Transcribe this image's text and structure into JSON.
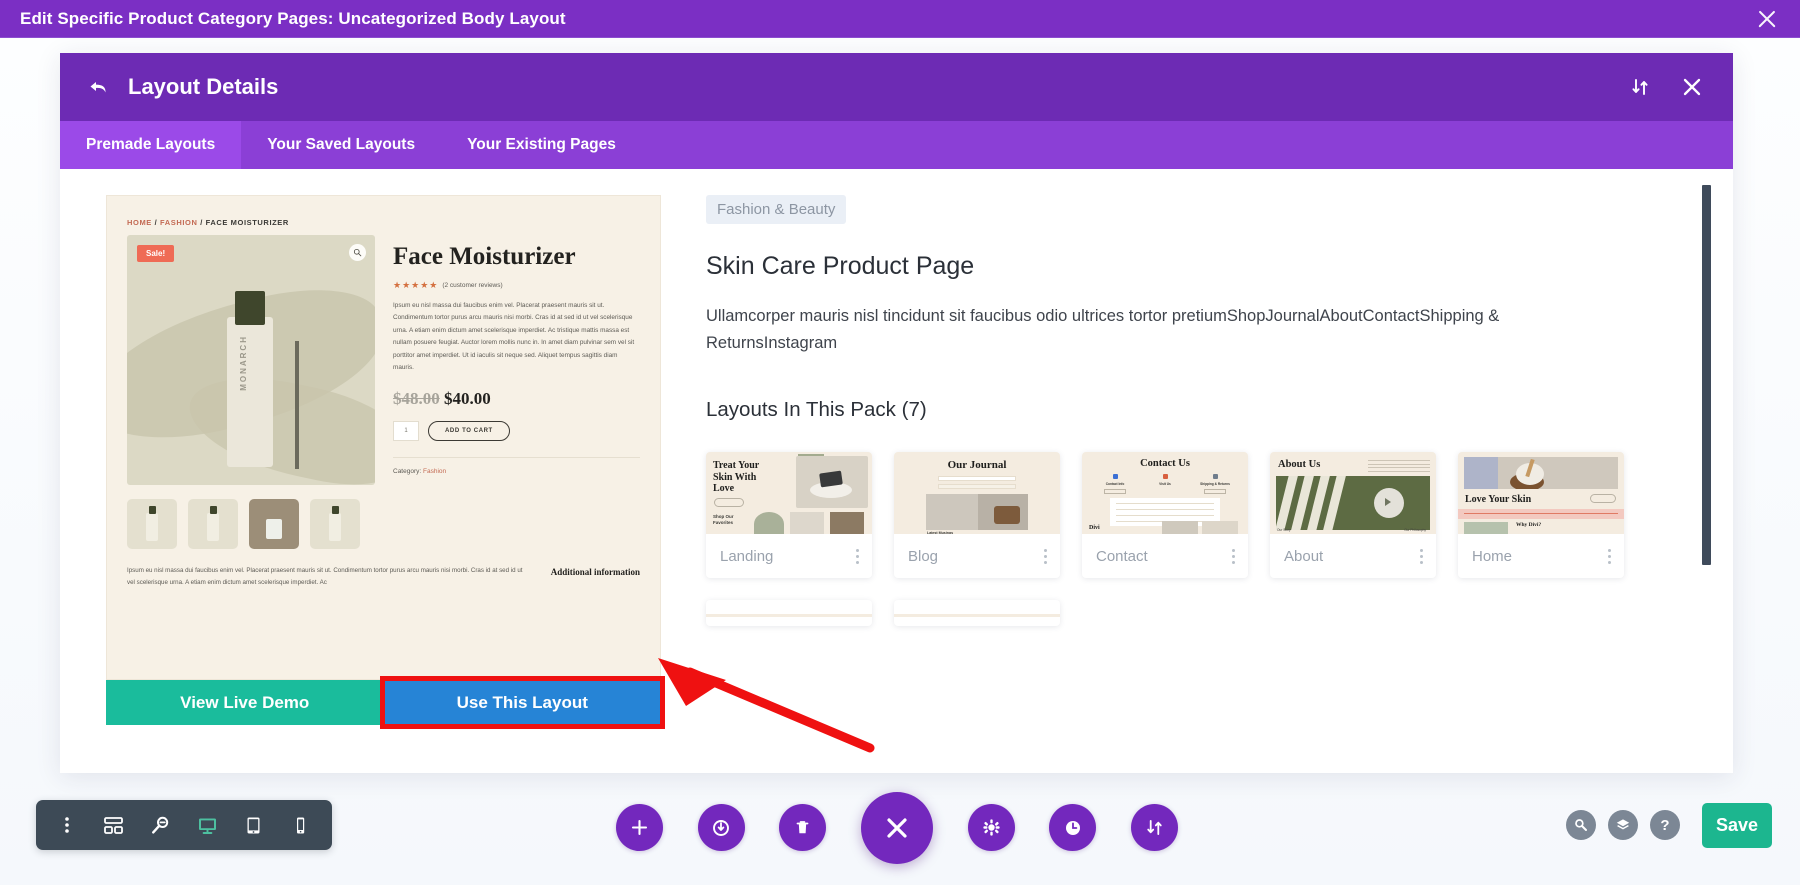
{
  "titlebar": {
    "title": "Edit Specific Product Category Pages: Uncategorized Body Layout",
    "close_icon": "close-icon"
  },
  "modal": {
    "header": {
      "back_icon": "back-arrow-icon",
      "title": "Layout Details",
      "sort_icon": "sort-arrows-icon",
      "close_icon": "close-icon"
    },
    "tabs": [
      {
        "label": "Premade Layouts",
        "active": true
      },
      {
        "label": "Your Saved Layouts",
        "active": false
      },
      {
        "label": "Your Existing Pages",
        "active": false
      }
    ]
  },
  "preview": {
    "breadcrumb_home": "HOME",
    "breadcrumb_cat": "FASHION",
    "breadcrumb_current": "/ FACE MOISTURIZER",
    "sale_badge": "Sale!",
    "zoom_icon": "magnifier-icon",
    "bottle_label": "MONARCH",
    "product_title": "Face Moisturizer",
    "stars": "★★★★★",
    "reviews": "(2 customer reviews)",
    "description": "Ipsum eu nisl massa dui faucibus enim vel. Placerat praesent mauris sit ut. Condimentum tortor purus arcu mauris nisi morbi. Cras id at sed id ut vel scelerisque urna. A etiam enim dictum amet scelerisque imperdiet. Ac tristique mattis massa est nullam posuere feugiat. Auctor lorem mollis nunc in. In amet diam pulvinar sem vel sit porttitor amet imperdiet. Ut id iaculis sit neque sed. Aliquet tempus sagittis diam mauris.",
    "price_old": "$48.00",
    "price_new": "$40.00",
    "qty_value": "1",
    "add_to_cart": "ADD TO CART",
    "category_label": "Category:",
    "category_value": "Fashion",
    "footer_text": "Ipsum eu nisl massa dui faucibus enim vel. Placerat praesent mauris sit ut. Condimentum tortor purus arcu mauris nisi morbi. Cras id at sed id ut vel scelerisque urna. A etiam enim dictum amet scelerisque imperdiet. Ac",
    "additional_info": "Additional information",
    "btn_demo": "View Live Demo",
    "btn_use": "Use This Layout"
  },
  "detail": {
    "category_badge": "Fashion & Beauty",
    "title": "Skin Care Product Page",
    "description": "Ullamcorper mauris nisl tincidunt sit faucibus odio ultrices tortor pretiumShopJournalAboutContactShipping & ReturnsInstagram",
    "pack_heading": "Layouts In This Pack (7)",
    "cards": [
      {
        "label": "Landing",
        "thumb_heading": "Treat Your\nSkin With\nLove",
        "thumb_sub": "Shop Our\nFavorites"
      },
      {
        "label": "Blog",
        "thumb_heading": "Our Journal",
        "thumb_sub": "Latest Musings"
      },
      {
        "label": "Contact",
        "thumb_heading": "Contact Us",
        "thumb_sub": "Divi",
        "cols": [
          {
            "label": "Contact Info",
            "btn": "Get In Touch"
          },
          {
            "label": "Visit Us",
            "btn": ""
          },
          {
            "label": "Shipping & Returns",
            "btn": "Read More"
          }
        ]
      },
      {
        "label": "About",
        "thumb_heading": "About Us",
        "cap_left": "Our Story",
        "cap_right": "Our Philosophy"
      },
      {
        "label": "Home",
        "thumb_heading": "Love Your Skin",
        "thumb_sub": "Why Divi?"
      }
    ],
    "menu_icon": "three-dots-vertical-icon",
    "scrollbar": "vertical-scrollbar"
  },
  "left_toolbar": {
    "items": [
      {
        "icon": "three-dots-vertical-icon",
        "active": false
      },
      {
        "icon": "wireframe-icon",
        "active": false
      },
      {
        "icon": "zoom-out-icon",
        "active": false
      },
      {
        "icon": "desktop-icon",
        "active": true
      },
      {
        "icon": "tablet-icon",
        "active": false
      },
      {
        "icon": "phone-icon",
        "active": false
      }
    ]
  },
  "center_bar": {
    "buttons": [
      {
        "icon": "plus-icon",
        "big": false
      },
      {
        "icon": "power-save-icon",
        "big": false
      },
      {
        "icon": "trash-icon",
        "big": false
      },
      {
        "icon": "close-x-icon",
        "big": true
      },
      {
        "icon": "gear-icon",
        "big": false
      },
      {
        "icon": "history-clock-icon",
        "big": false
      },
      {
        "icon": "sort-arrows-icon",
        "big": false
      }
    ]
  },
  "right_tools": {
    "buttons": [
      {
        "icon": "search-icon",
        "label": ""
      },
      {
        "icon": "layers-icon",
        "label": ""
      },
      {
        "icon": "help-icon",
        "label": "?"
      }
    ],
    "save_label": "Save"
  },
  "colors": {
    "titlebar_purple": "#7b2fc4",
    "modal_header_purple": "#6d2bb4",
    "tabbar_purple": "#8b3fd6",
    "tab_active_purple": "#9b4ae8",
    "demo_teal": "#1abc9c",
    "use_blue": "#2684d6",
    "annotation_red": "#ef1111",
    "save_teal": "#1cb68f",
    "toolbar_slate": "#3d4a56",
    "active_icon_teal": "#4dc0a0",
    "round_btn_purple": "#7328bd"
  }
}
